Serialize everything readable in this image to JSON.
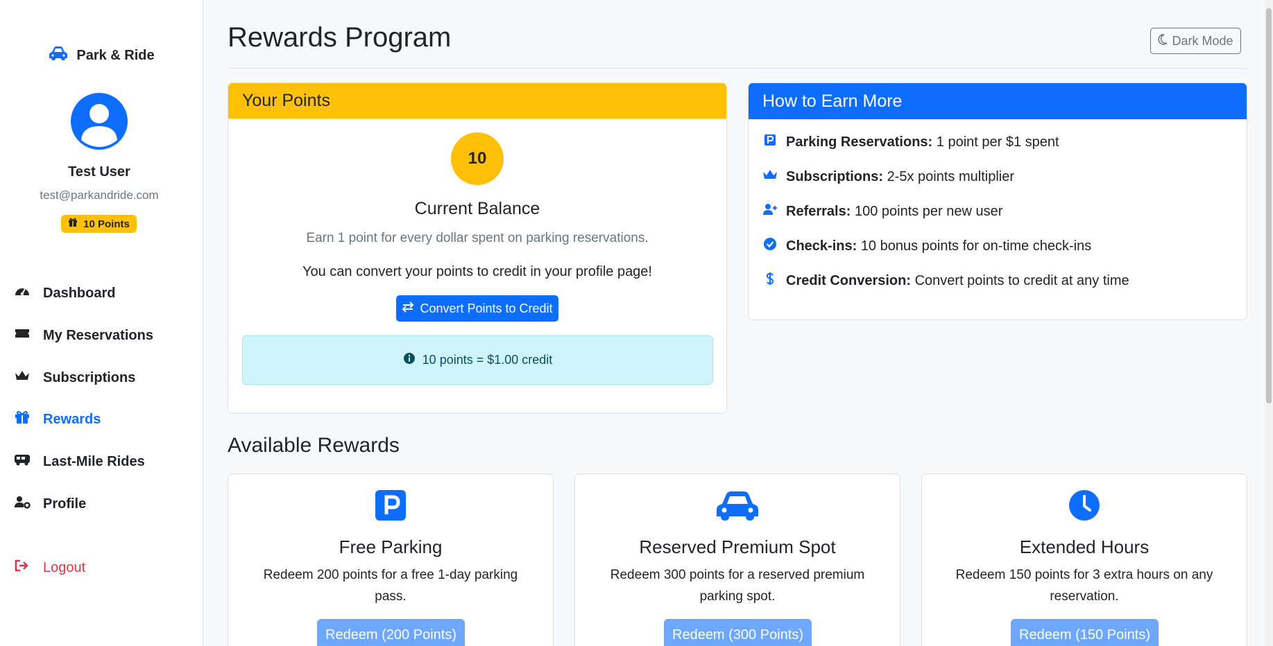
{
  "brand": {
    "name": "Park & Ride",
    "icon": "car-icon"
  },
  "user": {
    "name": "Test User",
    "email": "test@parkandride.com",
    "points_badge": "10 Points"
  },
  "nav": {
    "dashboard": "Dashboard",
    "reservations": "My Reservations",
    "subscriptions": "Subscriptions",
    "rewards": "Rewards",
    "last_mile": "Last-Mile Rides",
    "profile": "Profile",
    "logout": "Logout"
  },
  "header": {
    "title": "Rewards Program",
    "dark_mode_label": "Dark Mode"
  },
  "points_card": {
    "header": "Your Points",
    "balance": "10",
    "balance_title": "Current Balance",
    "earn_text": "Earn 1 point for every dollar spent on parking reservations.",
    "convert_text": "You can convert your points to credit in your profile page!",
    "convert_button": "Convert Points to Credit",
    "info": "10 points = $1.00 credit"
  },
  "earn_card": {
    "header": "How to Earn More",
    "items": [
      {
        "label": "Parking Reservations:",
        "text": "1 point per $1 spent",
        "icon": "parking-icon"
      },
      {
        "label": "Subscriptions:",
        "text": "2-5x points multiplier",
        "icon": "crown-icon"
      },
      {
        "label": "Referrals:",
        "text": "100 points per new user",
        "icon": "user-plus-icon"
      },
      {
        "label": "Check-ins:",
        "text": "10 bonus points for on-time check-ins",
        "icon": "check-circle-icon"
      },
      {
        "label": "Credit Conversion:",
        "text": "Convert points to credit at any time",
        "icon": "dollar-icon"
      }
    ]
  },
  "rewards": {
    "section_title": "Available Rewards",
    "items": [
      {
        "title": "Free Parking",
        "desc": "Redeem 200 points for a free 1-day parking pass.",
        "button": "Redeem (200 Points)",
        "icon": "parking-square-icon"
      },
      {
        "title": "Reserved Premium Spot",
        "desc": "Redeem 300 points for a reserved premium parking spot.",
        "button": "Redeem (300 Points)",
        "icon": "car-icon"
      },
      {
        "title": "Extended Hours",
        "desc": "Redeem 150 points for 3 extra hours on any reservation.",
        "button": "Redeem (150 Points)",
        "icon": "clock-icon"
      }
    ]
  },
  "colors": {
    "primary": "#0d6efd",
    "warning": "#ffc107",
    "danger": "#dc3545",
    "info_bg": "#cff4fc"
  }
}
